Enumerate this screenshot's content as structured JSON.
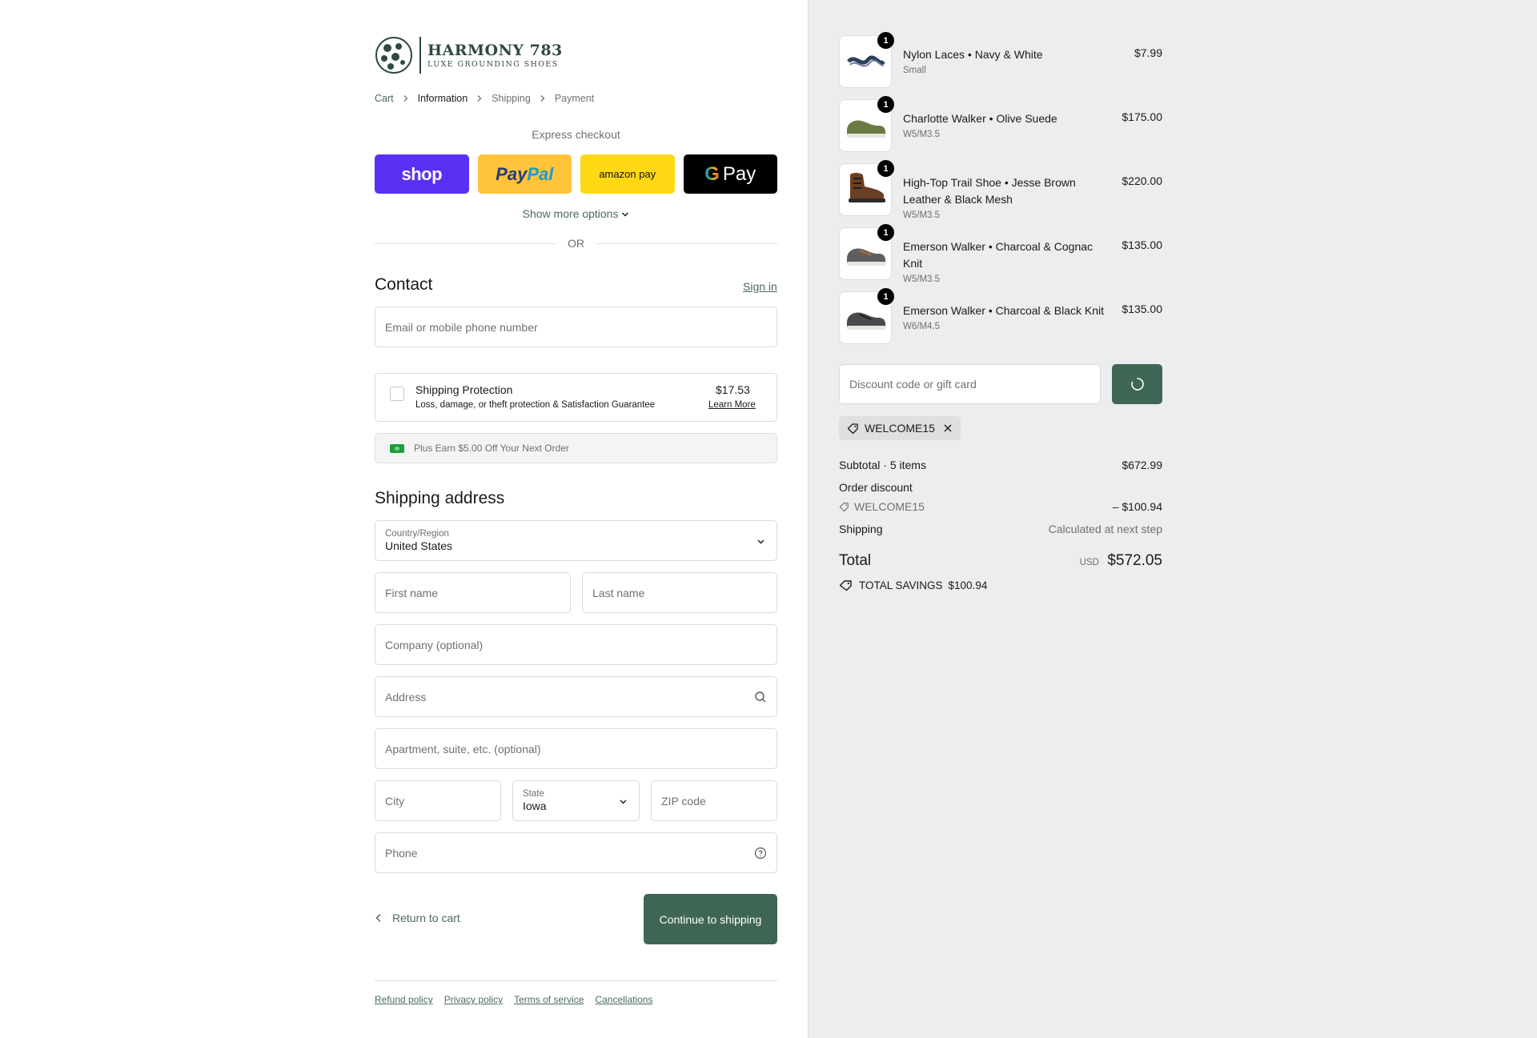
{
  "brand": {
    "name": "HARMONY 783",
    "tagline": "LUXE GROUNDING SHOES"
  },
  "breadcrumb": [
    "Cart",
    "Information",
    "Shipping",
    "Payment"
  ],
  "express": {
    "label": "Express checkout",
    "shop": "shop",
    "paypal_a": "Pay",
    "paypal_b": "Pal",
    "amazon": "amazon pay",
    "gpay": "Pay",
    "show_more": "Show more options"
  },
  "or": "OR",
  "contact": {
    "title": "Contact",
    "sign_in": "Sign in",
    "email_placeholder": "Email or mobile phone number"
  },
  "protection": {
    "title": "Shipping Protection",
    "subtitle": "Loss, damage, or theft protection & Satisfaction Guarantee",
    "price": "$17.53",
    "learn_more": "Learn More"
  },
  "earn": "Plus Earn $5.00 Off Your Next Order",
  "shipping": {
    "title": "Shipping address",
    "country_label": "Country/Region",
    "country_value": "United States",
    "first_name": "First name",
    "last_name": "Last name",
    "company": "Company (optional)",
    "address": "Address",
    "apartment": "Apartment, suite, etc. (optional)",
    "city": "City",
    "state_label": "State",
    "state_value": "Iowa",
    "zip": "ZIP code",
    "phone": "Phone"
  },
  "nav": {
    "return": "Return to cart",
    "continue": "Continue to shipping"
  },
  "footer": [
    "Refund policy",
    "Privacy policy",
    "Terms of service",
    "Cancellations"
  ],
  "cart": {
    "items": [
      {
        "name": "Nylon Laces • Navy & White",
        "variant": "Small",
        "price": "$7.99",
        "qty": "1"
      },
      {
        "name": "Charlotte Walker • Olive Suede",
        "variant": "W5/M3.5",
        "price": "$175.00",
        "qty": "1"
      },
      {
        "name": "High-Top Trail Shoe • Jesse Brown Leather & Black Mesh",
        "variant": "W5/M3.5",
        "price": "$220.00",
        "qty": "1"
      },
      {
        "name": "Emerson Walker • Charcoal & Cognac Knit",
        "variant": "W5/M3.5",
        "price": "$135.00",
        "qty": "1"
      },
      {
        "name": "Emerson Walker • Charcoal & Black Knit",
        "variant": "W6/M4.5",
        "price": "$135.00",
        "qty": "1"
      }
    ],
    "discount_placeholder": "Discount code or gift card",
    "applied_code": "WELCOME15",
    "subtotal_label": "Subtotal · 5 items",
    "subtotal_value": "$672.99",
    "order_discount_label": "Order discount",
    "discount_code": "WELCOME15",
    "discount_value": "– $100.94",
    "shipping_label": "Shipping",
    "shipping_value": "Calculated at next step",
    "total_label": "Total",
    "currency": "USD",
    "total_value": "$572.05",
    "savings_label": "TOTAL SAVINGS",
    "savings_value": "$100.94"
  },
  "colors": {
    "accent": "#3f6655",
    "link": "#4b6b5d",
    "sidebar_bg": "#ebedee"
  }
}
